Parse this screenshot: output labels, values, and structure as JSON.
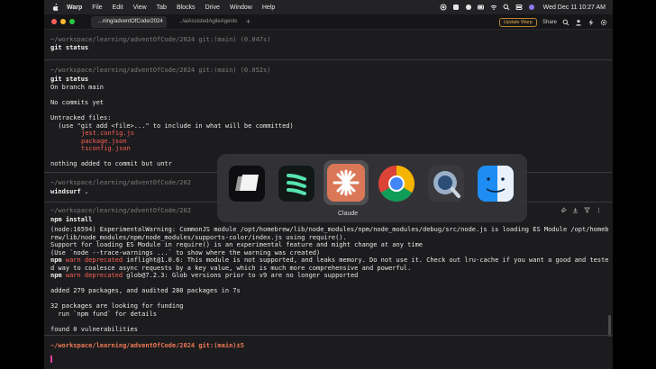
{
  "menubar": {
    "app_name": "Warp",
    "items": [
      "File",
      "Edit",
      "View",
      "Tab",
      "Blocks",
      "Drive",
      "Window",
      "Help"
    ],
    "clock": "Wed Dec 11  10:27 AM"
  },
  "tabs": {
    "active": "...ning/adventOfCode/2024",
    "inactive": "../aiAssistedAgileAgents",
    "update_label": "Update Warp",
    "share_label": "Share"
  },
  "terminal": {
    "block1": {
      "prompt": "~/workspace/learning/adventOfCode/2024 git:(main) (0.047s)",
      "command": "git status"
    },
    "block2": {
      "prompt": "~/workspace/learning/adventOfCode/2024 git:(main) (0.052s)",
      "command": "git status",
      "output": [
        "On branch main",
        "",
        "No commits yet",
        "",
        "Untracked files:",
        "  (use \"git add <file>...\" to include in what will be committed)"
      ],
      "untracked": [
        "jest.config.js",
        "package.json",
        "tsconfig.json"
      ],
      "tail": "nothing added to commit but untr"
    },
    "block3": {
      "prompt": "~/workspace/learning/adventOfCode/202",
      "command": "windsurf ."
    },
    "block4": {
      "prompt": "~/workspace/learning/adventOfCode/202",
      "command": "npm install",
      "output": [
        "(node:16594) ExperimentalWarning: CommonJS module /opt/homebrew/lib/node_modules/npm/node_modules/debug/src/node.js is loading ES Module /opt/homeb",
        "rew/lib/node_modules/npm/node_modules/supports-color/index.js using require().",
        "Support for loading ES Module in require() is an experimental feature and might change at any time",
        "(Use `node --trace-warnings ...` to show where the warning was created)"
      ],
      "warn1": {
        "pre": "npm ",
        "warn": "warn",
        "dep": " deprecated",
        "text": " inflight@1.0.6: This module is not supported, and leaks memory. Do not use it. Check out lru-cache if you want a good and teste"
      },
      "warn1_cont": "d way to coalesce async requests by a key value, which is much more comprehensive and powerful.",
      "warn2": {
        "pre": "npm ",
        "warn": "warn",
        "dep": " deprecated",
        "text": " glob@7.2.3: Glob versions prior to v9 are no longer supported"
      },
      "summary": [
        "",
        "added 279 packages, and audited 280 packages in 7s",
        "",
        "32 packages are looking for funding",
        "  run `npm fund` for details",
        "",
        "found 0 vulnerabilities"
      ]
    },
    "current_prompt": "~/workspace/learning/adventOfCode/2024 git:(main)±5"
  },
  "switcher": {
    "apps": [
      "Warp",
      "Windsurf",
      "Claude",
      "Chrome",
      "QuickTime Player",
      "Finder"
    ],
    "selected_label": "Claude"
  },
  "colors": {
    "accent_prompt": "#f07a55",
    "error_red": "#ff5f57",
    "claude_orange": "#d97757"
  }
}
